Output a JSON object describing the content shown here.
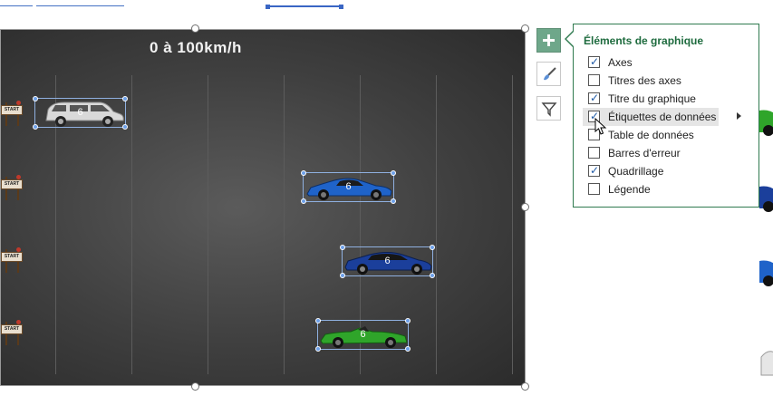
{
  "chart": {
    "title": "0 à 100km/h",
    "car_label": "6",
    "start_sign_text": "START"
  },
  "side_buttons": [
    {
      "name": "chart-elements-button",
      "icon": "plus-icon"
    },
    {
      "name": "chart-styles-button",
      "icon": "brush-icon"
    },
    {
      "name": "chart-filters-button",
      "icon": "filter-icon"
    }
  ],
  "panel": {
    "title": "Éléments de graphique",
    "items": [
      {
        "label": "Axes",
        "checked": true
      },
      {
        "label": "Titres des axes",
        "checked": false
      },
      {
        "label": "Titre du graphique",
        "checked": true
      },
      {
        "label": "Étiquettes de données",
        "checked": true
      },
      {
        "label": "Table de données",
        "checked": false
      },
      {
        "label": "Barres d'erreur",
        "checked": false
      },
      {
        "label": "Quadrillage",
        "checked": true
      },
      {
        "label": "Légende",
        "checked": false
      }
    ]
  },
  "colors": {
    "accent_green": "#1e6b3e",
    "check_blue": "#1f5aa6",
    "selection_blue": "#6ea0e8"
  }
}
